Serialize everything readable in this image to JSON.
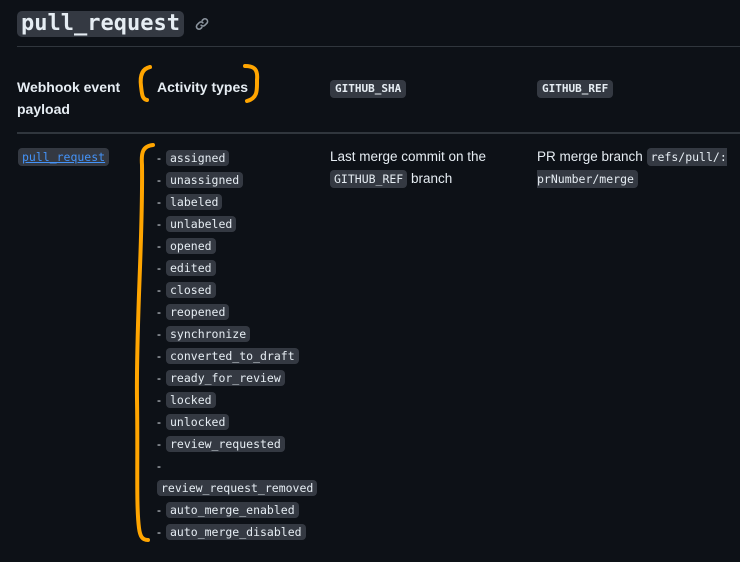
{
  "heading": {
    "title": "pull_request"
  },
  "table": {
    "headers": {
      "payload": "Webhook event payload",
      "activity": "Activity types",
      "sha": "GITHUB_SHA",
      "ref": "GITHUB_REF"
    },
    "row": {
      "event": "pull_request",
      "activity_types": [
        "assigned",
        "unassigned",
        "labeled",
        "unlabeled",
        "opened",
        "edited",
        "closed",
        "reopened",
        "synchronize",
        "converted_to_draft",
        "ready_for_review",
        "locked",
        "unlocked",
        "review_requested",
        "review_request_removed",
        "auto_merge_enabled",
        "auto_merge_disabled"
      ],
      "sha_text_before": "Last merge commit on the",
      "sha_code": "GITHUB_REF",
      "sha_text_after": "branch",
      "ref_text": "PR merge branch",
      "ref_code": "refs/pull/:prNumber/merge"
    }
  },
  "colors": {
    "background": "#0d1117",
    "link": "#4493f8",
    "annotation": "#ffa500",
    "code_bg": "#343942"
  },
  "icons": {
    "title_link": "link-icon"
  }
}
